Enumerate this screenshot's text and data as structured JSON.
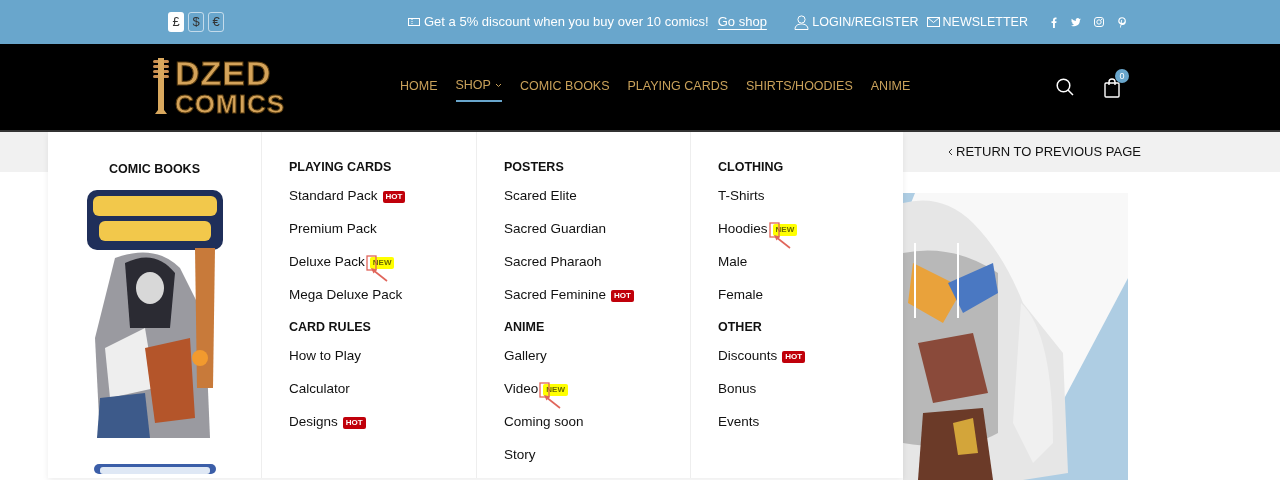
{
  "top_bar": {
    "currencies": [
      {
        "symbol": "£",
        "selected": true
      },
      {
        "symbol": "$",
        "selected": false
      },
      {
        "symbol": "€",
        "selected": false
      }
    ],
    "promo": {
      "text": "Get a 5% discount when you buy over 10 comics!",
      "link": "Go shop"
    },
    "account_links": [
      {
        "label": "LOGIN/REGISTER",
        "kind": "user"
      },
      {
        "label": "NEWSLETTER",
        "kind": "mail"
      }
    ],
    "social": [
      {
        "kind": "facebook"
      },
      {
        "kind": "twitter"
      },
      {
        "kind": "instagram"
      },
      {
        "kind": "pinterest"
      }
    ]
  },
  "header": {
    "logo": {
      "line_1": "DZED",
      "line_2": "COMICS"
    },
    "nav": [
      {
        "label": "HOME",
        "selected": false,
        "dropdown": false
      },
      {
        "label": "SHOP",
        "selected": true,
        "dropdown": true
      },
      {
        "label": "COMIC BOOKS",
        "selected": false,
        "dropdown": false
      },
      {
        "label": "PLAYING CARDS",
        "selected": false,
        "dropdown": false
      },
      {
        "label": "SHIRTS/HOODIES",
        "selected": false,
        "dropdown": false
      },
      {
        "label": "ANIME",
        "selected": false,
        "dropdown": false
      }
    ],
    "cart": {
      "count": "0"
    }
  },
  "return_link": "RETURN TO PREVIOUS PAGE",
  "mega_menu": {
    "featured": {
      "heading": "COMIC BOOKS"
    },
    "sections": [
      {
        "heading": "PLAYING CARDS",
        "items": [
          {
            "label": "Standard Pack",
            "badge": {
              "text": "HOT",
              "kind": "hot"
            },
            "annotated": false
          },
          {
            "label": "Premium Pack",
            "annotated": false
          },
          {
            "label": "Deluxe Pack",
            "badge": {
              "text": "NEW",
              "kind": "new"
            },
            "annotated": true
          },
          {
            "label": "Mega Deluxe Pack",
            "annotated": false
          }
        ]
      },
      {
        "heading": "POSTERS",
        "items": [
          {
            "label": "Scared Elite",
            "annotated": false
          },
          {
            "label": "Sacred Guardian",
            "annotated": false
          },
          {
            "label": "Sacred Pharaoh",
            "annotated": false
          },
          {
            "label": "Sacred Feminine",
            "badge": {
              "text": "HOT",
              "kind": "hot"
            },
            "annotated": false
          }
        ]
      },
      {
        "heading": "CLOTHING",
        "items": [
          {
            "label": "T-Shirts",
            "annotated": false
          },
          {
            "label": "Hoodies",
            "badge": {
              "text": "NEW",
              "kind": "new"
            },
            "annotated": true
          },
          {
            "label": "Male",
            "annotated": false
          },
          {
            "label": "Female",
            "annotated": false
          }
        ]
      },
      {
        "heading": "CARD RULES",
        "items": [
          {
            "label": "How to Play",
            "annotated": false
          },
          {
            "label": "Calculator",
            "annotated": false
          },
          {
            "label": "Designs",
            "badge": {
              "text": "HOT",
              "kind": "hot"
            },
            "annotated": false
          }
        ]
      },
      {
        "heading": "ANIME",
        "items": [
          {
            "label": "Gallery",
            "annotated": false
          },
          {
            "label": "Video",
            "badge": {
              "text": "NEW",
              "kind": "new"
            },
            "annotated": true
          },
          {
            "label": "Coming soon",
            "annotated": false
          },
          {
            "label": "Story",
            "annotated": false
          }
        ]
      },
      {
        "heading": "OTHER",
        "items": [
          {
            "label": "Discounts",
            "badge": {
              "text": "HOT",
              "kind": "hot"
            },
            "annotated": false
          },
          {
            "label": "Bonus",
            "annotated": false
          },
          {
            "label": "Events",
            "annotated": false
          }
        ]
      }
    ]
  }
}
